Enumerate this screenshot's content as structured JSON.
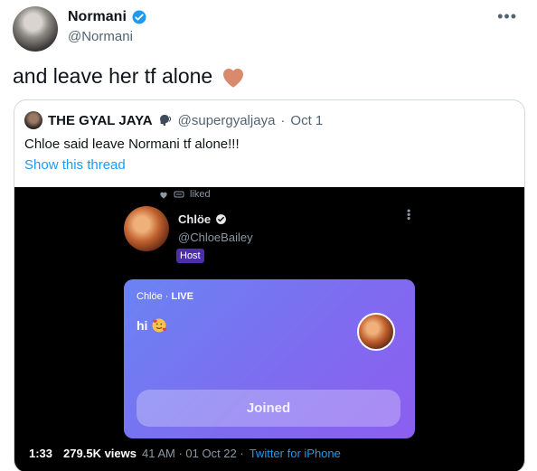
{
  "tweet": {
    "author_name": "Normani",
    "author_handle": "@Normani",
    "text": "and leave her tf alone",
    "more_icon": "more-horizontal-icon",
    "verified_icon": "verified-badge-icon",
    "heart_emoji": "heart-icon"
  },
  "quote": {
    "author_name": "THE GYAL JAYA",
    "author_handle": "@supergyaljaya",
    "date": "Oct 1",
    "separator": "·",
    "text": "Chloe said leave Normani tf alone!!!",
    "show_thread": "Show this thread"
  },
  "media": {
    "liked_label": "liked",
    "host_name": "Chlöe",
    "host_handle": "@ChloeBailey",
    "host_badge": "Host",
    "card": {
      "space_label": "Chlöe · ",
      "live_label": "LIVE",
      "message": "hi",
      "joined_button": "Joined"
    },
    "time": "1:33",
    "views": "279.5K views",
    "timestamp": "41 AM · 01 Oct 22 · ",
    "source": "Twitter for iPhone"
  },
  "colors": {
    "link_blue": "#1d9bf0",
    "verified_blue": "#1d9bf0",
    "host_purple": "#4c2fa8",
    "heart": "#d98a6c"
  }
}
